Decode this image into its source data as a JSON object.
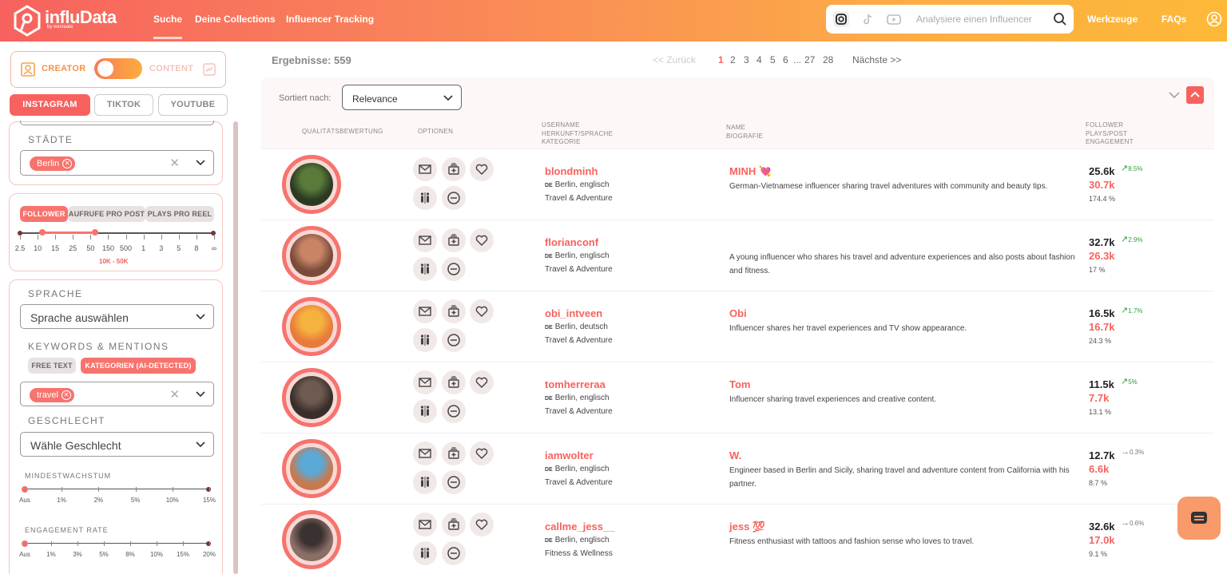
{
  "header": {
    "logo_text": "influData",
    "logo_sub": "by wecreate",
    "nav": [
      "Suche",
      "Deine Collections",
      "Influencer Tracking"
    ],
    "search_placeholder": "Analysiere einen Influencer",
    "right_nav": [
      "Werkzeuge",
      "FAQs"
    ]
  },
  "sidebar": {
    "toggle": {
      "left": "CREATOR",
      "right": "CONTENT"
    },
    "platform_tabs": [
      "INSTAGRAM",
      "TIKTOK",
      "YOUTUBE"
    ],
    "cities": {
      "label": "STÄDTE",
      "chip": "Berlin"
    },
    "metric_tabs": [
      "FOLLOWER",
      "AUFRUFE PRO POST",
      "PLAYS PRO REEL"
    ],
    "follower_ticks": [
      "2.5",
      "10",
      "15",
      "25",
      "50",
      "150",
      "500",
      "1",
      "3",
      "5",
      "8",
      "∞"
    ],
    "follower_range": "10K - 50K",
    "language": {
      "label": "SPRACHE",
      "placeholder": "Sprache auswählen"
    },
    "keywords": {
      "label": "KEYWORDS & MENTIONS",
      "tabs": [
        "FREE TEXT",
        "KATEGORIEN (AI-DETECTED)"
      ],
      "chip": "travel"
    },
    "gender": {
      "label": "GESCHLECHT",
      "placeholder": "Wähle Geschlecht"
    },
    "growth": {
      "label": "MINDESTWACHSTUM",
      "ticks": [
        "Aus",
        "1%",
        "2%",
        "5%",
        "10%",
        "15%"
      ]
    },
    "engagement": {
      "label": "ENGAGEMENT RATE",
      "ticks": [
        "Aus",
        "1%",
        "3%",
        "5%",
        "8%",
        "10%",
        "15%",
        "20%"
      ]
    }
  },
  "main": {
    "results": "Ergebnisse: 559",
    "pagination": {
      "prev": "<< Zurück",
      "pages": [
        "1",
        "2",
        "3",
        "4",
        "5",
        "6",
        "...",
        "27",
        "28"
      ],
      "next": "Nächste >>"
    },
    "sort": {
      "label": "Sortiert nach:",
      "value": "Relevance"
    },
    "columns": {
      "quality": "QUALITÄTSBEWERTUNG",
      "options": "OPTIONEN",
      "user": "USERNAME\nHERKUNFT/SPRACHE\nKATEGORIE",
      "name": "NAME\nBIOGRAFIE",
      "stats": "FOLLOWER\nPLAYS/POST\nENGAGEMENT"
    },
    "rows": [
      {
        "username": "blondminh",
        "flag": "DE",
        "location": "Berlin, englisch",
        "category": "Travel & Adventure",
        "name": "MINH 💘",
        "bio": "German-Vietnamese influencer sharing travel adventures with community and beauty tips.",
        "followers": "25.6k",
        "growth": "8.5%",
        "growth_dir": "up",
        "plays": "30.7k",
        "engagement": "174.4 %"
      },
      {
        "username": "florianconf",
        "flag": "DE",
        "location": "Berlin, englisch",
        "category": "Travel & Adventure",
        "name": "",
        "bio": "A young influencer who shares his travel and adventure experiences and also posts about fashion and fitness.",
        "followers": "32.7k",
        "growth": "2.9%",
        "growth_dir": "up",
        "plays": "26.3k",
        "engagement": "17 %"
      },
      {
        "username": "obi_intveen",
        "flag": "DE",
        "location": "Berlin, deutsch",
        "category": "Travel & Adventure",
        "name": "Obi",
        "bio": "Influencer shares her travel experiences and TV show appearance.",
        "followers": "16.5k",
        "growth": "1.7%",
        "growth_dir": "up",
        "plays": "16.7k",
        "engagement": "24.3 %"
      },
      {
        "username": "tomherreraa",
        "flag": "DE",
        "location": "Berlin, englisch",
        "category": "Travel & Adventure",
        "name": "Tom",
        "bio": "Influencer sharing travel experiences and creative content.",
        "followers": "11.5k",
        "growth": "5%",
        "growth_dir": "up",
        "plays": "7.7k",
        "engagement": "13.1 %"
      },
      {
        "username": "iamwolter",
        "flag": "DE",
        "location": "Berlin, englisch",
        "category": "Travel & Adventure",
        "name": "W.",
        "bio": "Engineer based in Berlin and Sicily, sharing travel and adventure content from California with his partner.",
        "followers": "12.7k",
        "growth": "0.3%",
        "growth_dir": "flat",
        "plays": "6.6k",
        "engagement": "8.7 %"
      },
      {
        "username": "callme_jess__",
        "flag": "DE",
        "location": "Berlin, englisch",
        "category": "Fitness & Wellness",
        "name": "jess 💯",
        "bio": "Fitness enthusiast with tattoos and fashion sense who loves to travel.",
        "followers": "32.6k",
        "growth": "0.6%",
        "growth_dir": "flat",
        "plays": "17.0k",
        "engagement": "9.1 %"
      }
    ]
  },
  "colors": {
    "accent": "#f7625e",
    "green": "#2e9e3a"
  }
}
